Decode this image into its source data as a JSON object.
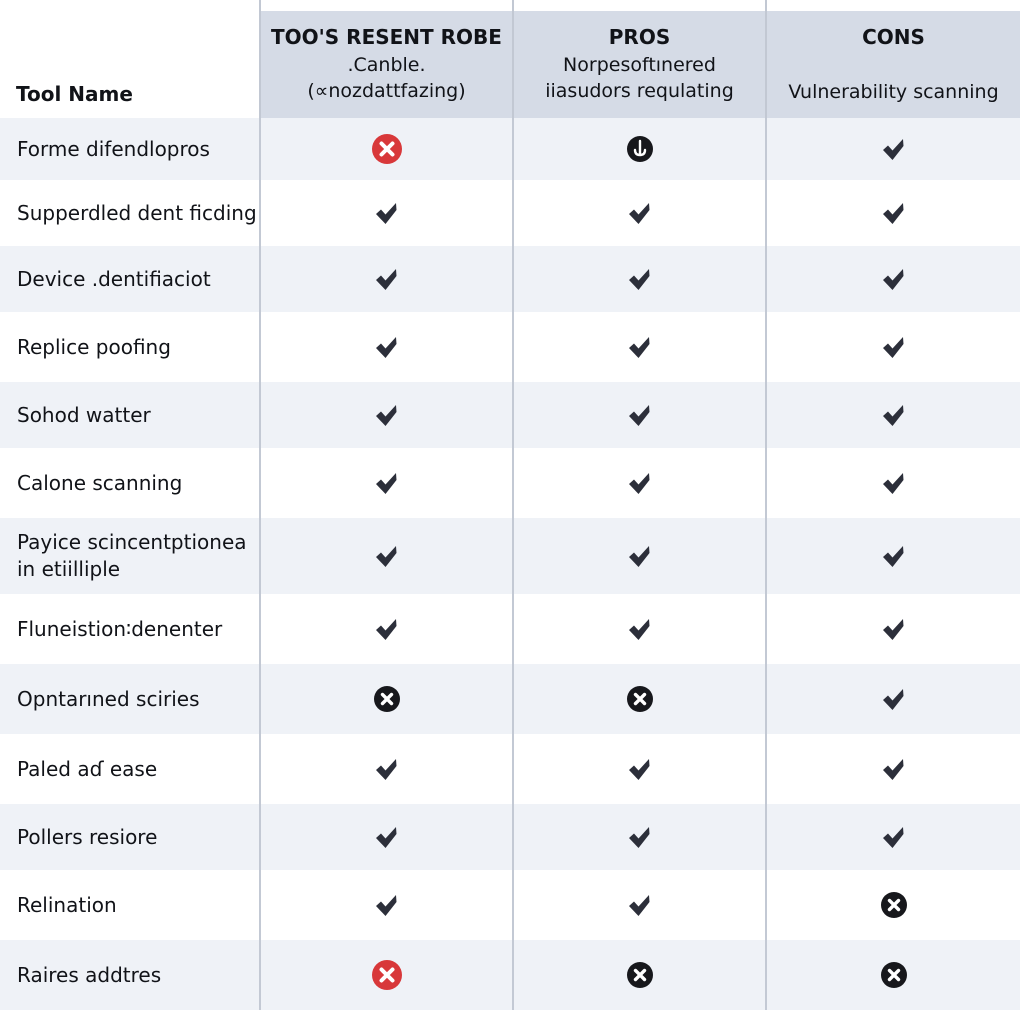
{
  "colors": {
    "header_bg": "#d5dbe6",
    "row_alt_bg": "#eff2f7",
    "check": "#2c2f3a",
    "x_red": "#d8383a",
    "x_dark": "#17181c"
  },
  "table": {
    "columns": [
      {
        "title": "Tool Name",
        "subtitle": ""
      },
      {
        "title": "TOO'S RESENT ROBE",
        "subtitle": ".Canble.\n(∝nozdattfazing)"
      },
      {
        "title": "PROS",
        "subtitle": "Norpesoftınered\niiasudors requlating"
      },
      {
        "title": "CONS",
        "subtitle": "Vulnerability scanning"
      }
    ],
    "rows": [
      {
        "name": "Forme difendlopros",
        "values": [
          "x-red",
          "anchor-dark",
          "check"
        ]
      },
      {
        "name": "Supperdled  dent ficding",
        "values": [
          "check",
          "check",
          "check"
        ]
      },
      {
        "name": "Device .dentifiaciot",
        "values": [
          "check",
          "check",
          "check"
        ]
      },
      {
        "name": "Replice poofing",
        "values": [
          "check",
          "check",
          "check"
        ]
      },
      {
        "name": "Sohod watter",
        "values": [
          "check",
          "check",
          "check"
        ]
      },
      {
        "name": "Calone scanning",
        "values": [
          "check",
          "check",
          "check"
        ]
      },
      {
        "name": "Payice scincentptionea\nin etiilliple",
        "values": [
          "check",
          "check",
          "check"
        ]
      },
      {
        "name": "Fluneistion∶denenter",
        "values": [
          "check",
          "check",
          "check"
        ]
      },
      {
        "name": "Opntarıned sciries",
        "values": [
          "x-dark",
          "x-dark",
          "check"
        ]
      },
      {
        "name": "Paled aɗ ease",
        "values": [
          "check",
          "check",
          "check"
        ]
      },
      {
        "name": "Pollers resiore",
        "values": [
          "check",
          "check",
          "check"
        ]
      },
      {
        "name": "Relination",
        "values": [
          "check",
          "check",
          "x-dark"
        ]
      },
      {
        "name": "Raires addtres",
        "values": [
          "x-red",
          "x-dark",
          "x-dark"
        ]
      }
    ]
  },
  "icons": {
    "check": "checkmark-icon",
    "x-red": "x-circle-red-icon",
    "x-dark": "x-circle-dark-icon",
    "anchor-dark": "anchor-circle-icon"
  }
}
